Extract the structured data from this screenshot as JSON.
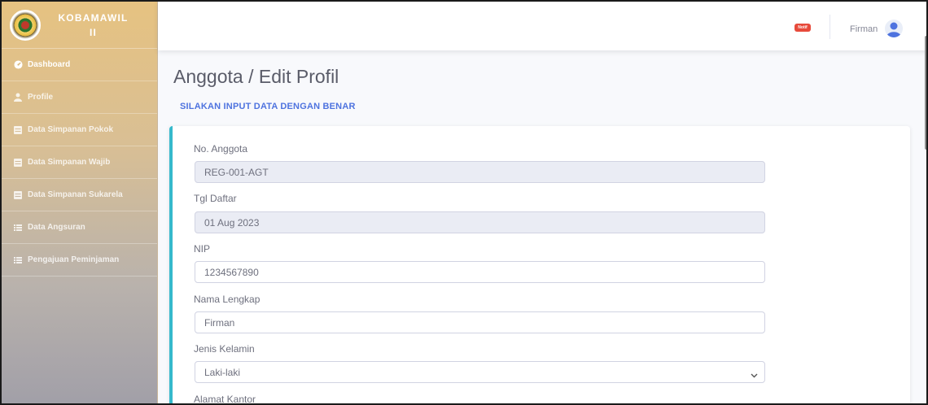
{
  "brand": {
    "line1": "KOBAMAWIL",
    "line2": "II"
  },
  "sidebar": {
    "items": [
      {
        "label": "Dashboard",
        "icon": "tachometer-icon"
      },
      {
        "label": "Profile",
        "icon": "user-icon"
      },
      {
        "label": "Data Simpanan Pokok",
        "icon": "table-icon"
      },
      {
        "label": "Data Simpanan Wajib",
        "icon": "table-icon"
      },
      {
        "label": "Data Simpanan Sukarela",
        "icon": "table-icon"
      },
      {
        "label": "Data Angsuran",
        "icon": "list-icon"
      },
      {
        "label": "Pengajuan Peminjaman",
        "icon": "list-icon"
      }
    ]
  },
  "topbar": {
    "notif_label": "Notif",
    "user_name": "Firman"
  },
  "page": {
    "title": "Anggota / Edit Profil",
    "subtitle": "SILAKAN INPUT DATA DENGAN BENAR"
  },
  "form": {
    "no_anggota": {
      "label": "No. Anggota",
      "value": "REG-001-AGT"
    },
    "tgl_daftar": {
      "label": "Tgl Daftar",
      "value": "01 Aug 2023"
    },
    "nip": {
      "label": "NIP",
      "value": "1234567890"
    },
    "nama_lengkap": {
      "label": "Nama Lengkap",
      "value": "Firman"
    },
    "jenis_kelamin": {
      "label": "Jenis Kelamin",
      "value": "Laki-laki"
    },
    "alamat_kantor": {
      "label": "Alamat Kantor"
    }
  },
  "colors": {
    "primary": "#4e73df",
    "info_border": "#36b9cc",
    "danger": "#e74a3b",
    "sidebar_top": "#e6c281",
    "sidebar_bottom": "#a19fa8"
  }
}
